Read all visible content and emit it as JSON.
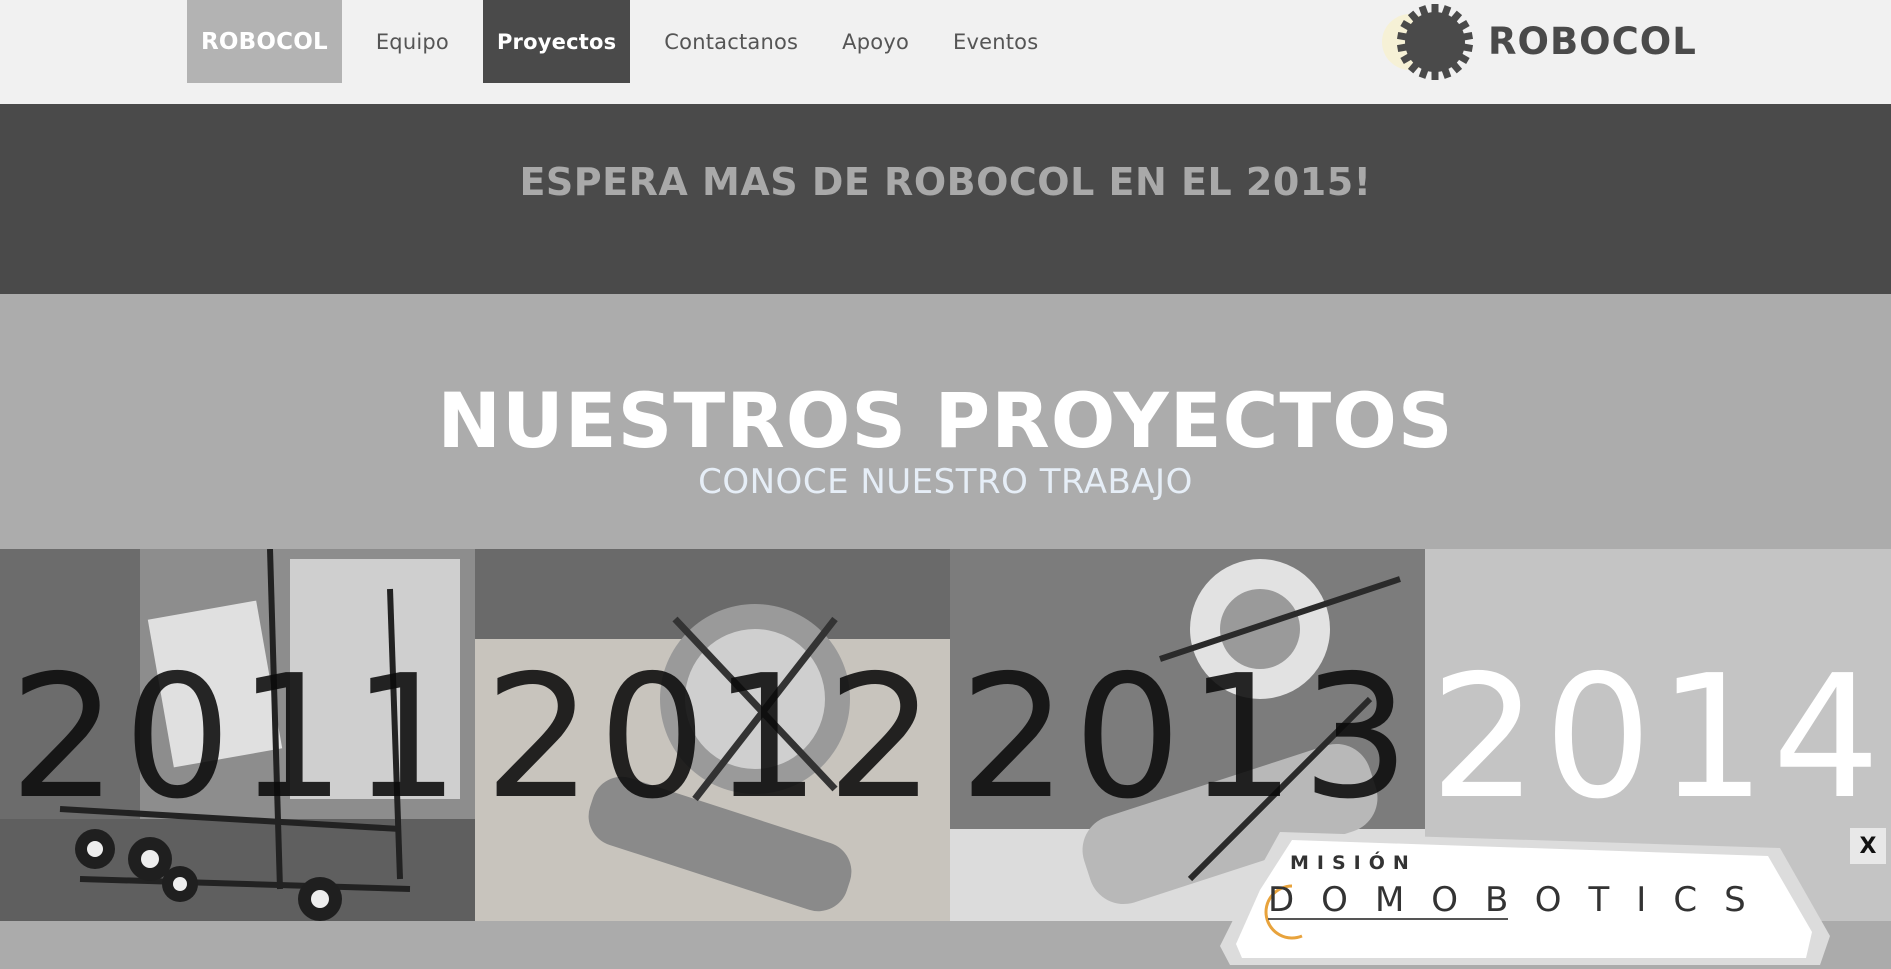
{
  "nav": {
    "brand": "ROBOCOL",
    "items": [
      {
        "label": "Equipo",
        "active": false
      },
      {
        "label": "Proyectos",
        "active": true
      },
      {
        "label": "Contactanos",
        "active": false
      },
      {
        "label": "Apoyo",
        "active": false
      },
      {
        "label": "Eventos",
        "active": false
      }
    ]
  },
  "logo": {
    "text": "ROBOCOL",
    "icon": "gear-icon"
  },
  "banner": {
    "text": "ESPERA MAS DE ROBOCOL EN EL 2015!"
  },
  "projects": {
    "title": "NUESTROS PROYECTOS",
    "subtitle": "CONOCE NUESTRO TRABAJO",
    "tiles": [
      {
        "year": "2011"
      },
      {
        "year": "2012"
      },
      {
        "year": "2013"
      },
      {
        "year": "2014"
      }
    ]
  },
  "popup": {
    "line1": "MISIÓN",
    "line2": "DOMOBOTICS",
    "close_label": "X"
  },
  "colors": {
    "nav_bg": "#f1f1f1",
    "banner_bg": "#4a4a4a",
    "section_bg": "#acacac",
    "active_nav": "#4a4a4a",
    "accent_orange": "#e8a33c"
  }
}
